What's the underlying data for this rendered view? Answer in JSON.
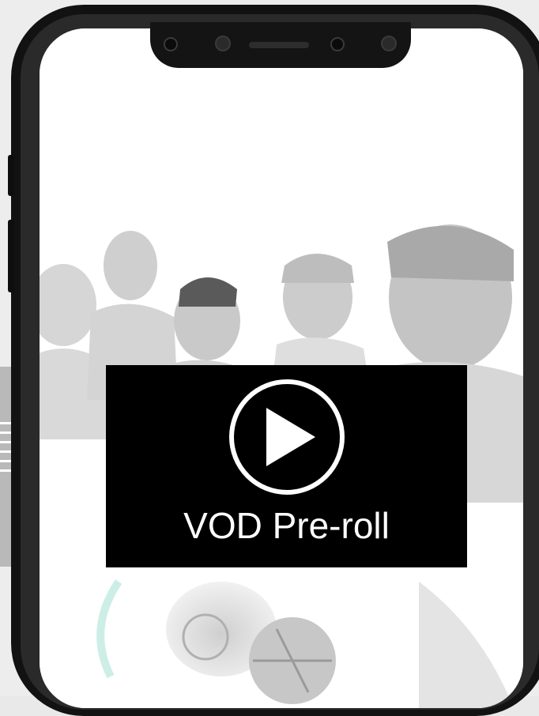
{
  "player": {
    "label": "VOD Pre-roll",
    "icon": "play-circle-icon",
    "background": "#000000",
    "foreground": "#ffffff"
  },
  "colors": {
    "phone_frame": "#121212",
    "screen": "#ffffff",
    "side_cards": "#b9b9b9"
  }
}
